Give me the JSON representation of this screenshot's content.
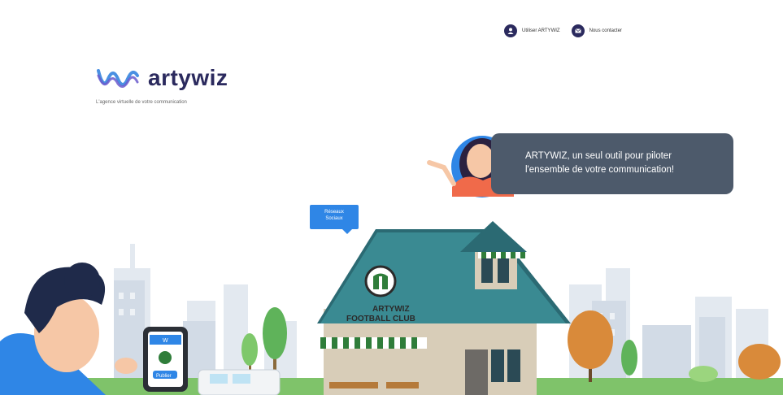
{
  "topnav": {
    "links": [
      {
        "label": "Utiliser ARTYWIZ",
        "icon": "user-icon"
      },
      {
        "label": "Nous contacter",
        "icon": "mail-icon"
      }
    ]
  },
  "brand": {
    "name": "artywiz",
    "tagline": "L'agence virtuelle de votre communication",
    "color": "#2b2a5e",
    "accent": "#4a90e2"
  },
  "speech_bubble": {
    "line1": "ARTYWIZ, un seul outil pour piloter",
    "line2": "l'ensemble de votre communication!"
  },
  "tag": {
    "line1": "Réseaux",
    "line2": "Sociaux"
  },
  "club_sign": {
    "line1": "ARTYWIZ",
    "line2": "FOOTBALL CLUB"
  },
  "phone": {
    "top": "W",
    "button": "Publier"
  }
}
